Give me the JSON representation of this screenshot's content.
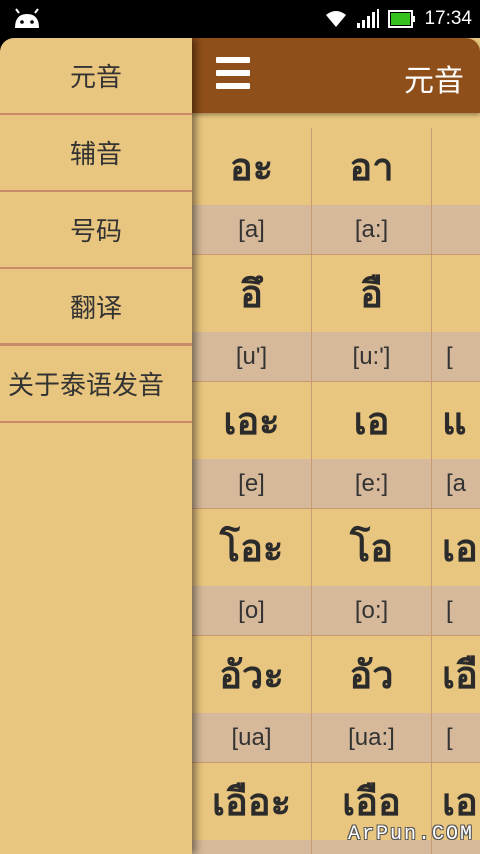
{
  "status_bar": {
    "time": "17:34",
    "icons": [
      "android-icon",
      "wifi-icon",
      "signal-icon",
      "battery-icon"
    ],
    "battery_color": "#35c21e"
  },
  "action_bar": {
    "title": "元音",
    "menu_icon": "hamburger-menu-icon",
    "color": "#8e4f1a"
  },
  "drawer": {
    "items": [
      {
        "label": "元音"
      },
      {
        "label": "辅音"
      },
      {
        "label": "号码"
      },
      {
        "label": "翻译"
      },
      {
        "label": "关于泰语发音"
      }
    ]
  },
  "vowel_grid": {
    "rows": [
      [
        {
          "thai": "อะ",
          "ipa": "[a]"
        },
        {
          "thai": "อา",
          "ipa": "[a:]"
        },
        {
          "thai": "",
          "ipa": ""
        }
      ],
      [
        {
          "thai": "อึ",
          "ipa": "[u']"
        },
        {
          "thai": "อื",
          "ipa": "[u:']"
        },
        {
          "thai": "",
          "ipa": "["
        }
      ],
      [
        {
          "thai": "เอะ",
          "ipa": "[e]"
        },
        {
          "thai": "เอ",
          "ipa": "[e:]"
        },
        {
          "thai": "แ",
          "ipa": "[a"
        }
      ],
      [
        {
          "thai": "โอะ",
          "ipa": "[o]"
        },
        {
          "thai": "โอ",
          "ipa": "[o:]"
        },
        {
          "thai": "เอ",
          "ipa": "["
        }
      ],
      [
        {
          "thai": "อัวะ",
          "ipa": "[ua]"
        },
        {
          "thai": "อัว",
          "ipa": "[ua:]"
        },
        {
          "thai": "เอื",
          "ipa": "["
        }
      ],
      [
        {
          "thai": "เอือะ",
          "ipa": ""
        },
        {
          "thai": "เอือ",
          "ipa": ""
        },
        {
          "thai": "เอ",
          "ipa": ""
        }
      ]
    ],
    "cell_color": "#e9c67f",
    "ipa_band_color": "#d6b99a"
  },
  "watermark": "ArPun.COM"
}
